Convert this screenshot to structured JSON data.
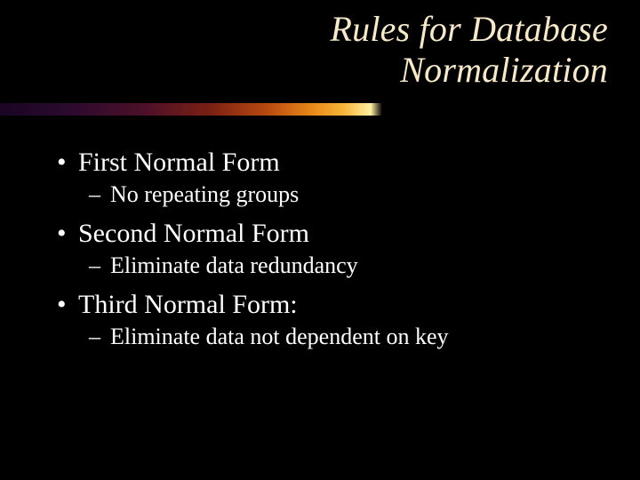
{
  "title_line1": "Rules for Database",
  "title_line2": "Normalization",
  "items": [
    {
      "label": "First Normal Form",
      "sub": "No repeating groups"
    },
    {
      "label": "Second Normal Form",
      "sub": "Eliminate data redundancy"
    },
    {
      "label": "Third Normal Form:",
      "sub": "Eliminate data not dependent on key"
    }
  ],
  "bullets": {
    "dot": "•",
    "dash": "–"
  }
}
